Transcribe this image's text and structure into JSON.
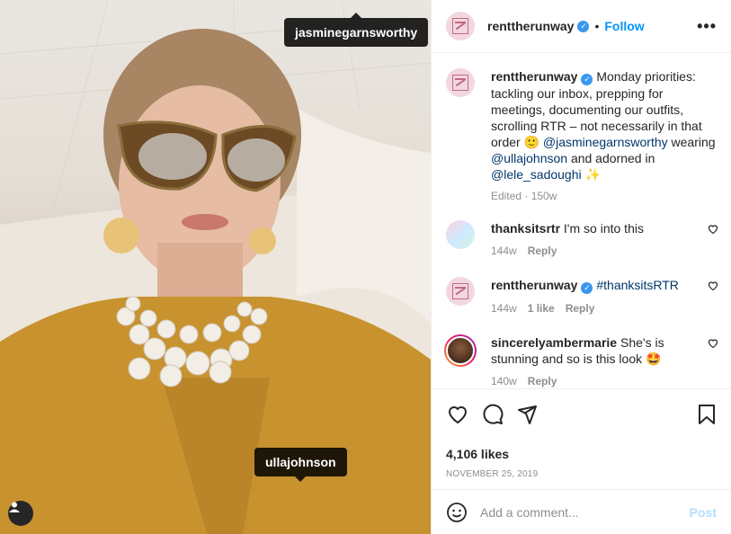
{
  "photo": {
    "tags": [
      "jasminegarnsworthy",
      "ullajohnson"
    ]
  },
  "header": {
    "username": "renttherunway",
    "separator": "•",
    "follow_label": "Follow",
    "more_label": "•••"
  },
  "caption": {
    "username": "renttherunway",
    "text": "Monday priorities: tackling our inbox, prepping for meetings, documenting our outfits, scrolling RTR – not necessarily in that order 🙂",
    "mention1": "@jasminegarnsworthy",
    "mid": "wearing",
    "mention2": "@ullajohnson",
    "mid2": "and adorned in",
    "mention3": "@lele_sadoughi",
    "emoji_end": "✨",
    "meta": "Edited · 150w"
  },
  "comments": [
    {
      "username": "thanksitsrtr",
      "text": "I'm so into this",
      "time": "144w",
      "likes": "",
      "reply": "Reply"
    },
    {
      "username": "renttherunway",
      "text": "#thanksitsRTR",
      "time": "144w",
      "likes": "1 like",
      "reply": "Reply"
    },
    {
      "username": "sincerelyambermarie",
      "text": "She's is stunning and so is this look 🤩",
      "time": "140w",
      "likes": "",
      "reply": "Reply"
    }
  ],
  "post": {
    "likes": "4,106 likes",
    "date": "NOVEMBER 25, 2019"
  },
  "add_comment": {
    "placeholder": "Add a comment...",
    "post_label": "Post"
  },
  "colors": {
    "accent": "#0095f6",
    "verified": "#3897f0",
    "post_disabled": "#b2dffc"
  }
}
